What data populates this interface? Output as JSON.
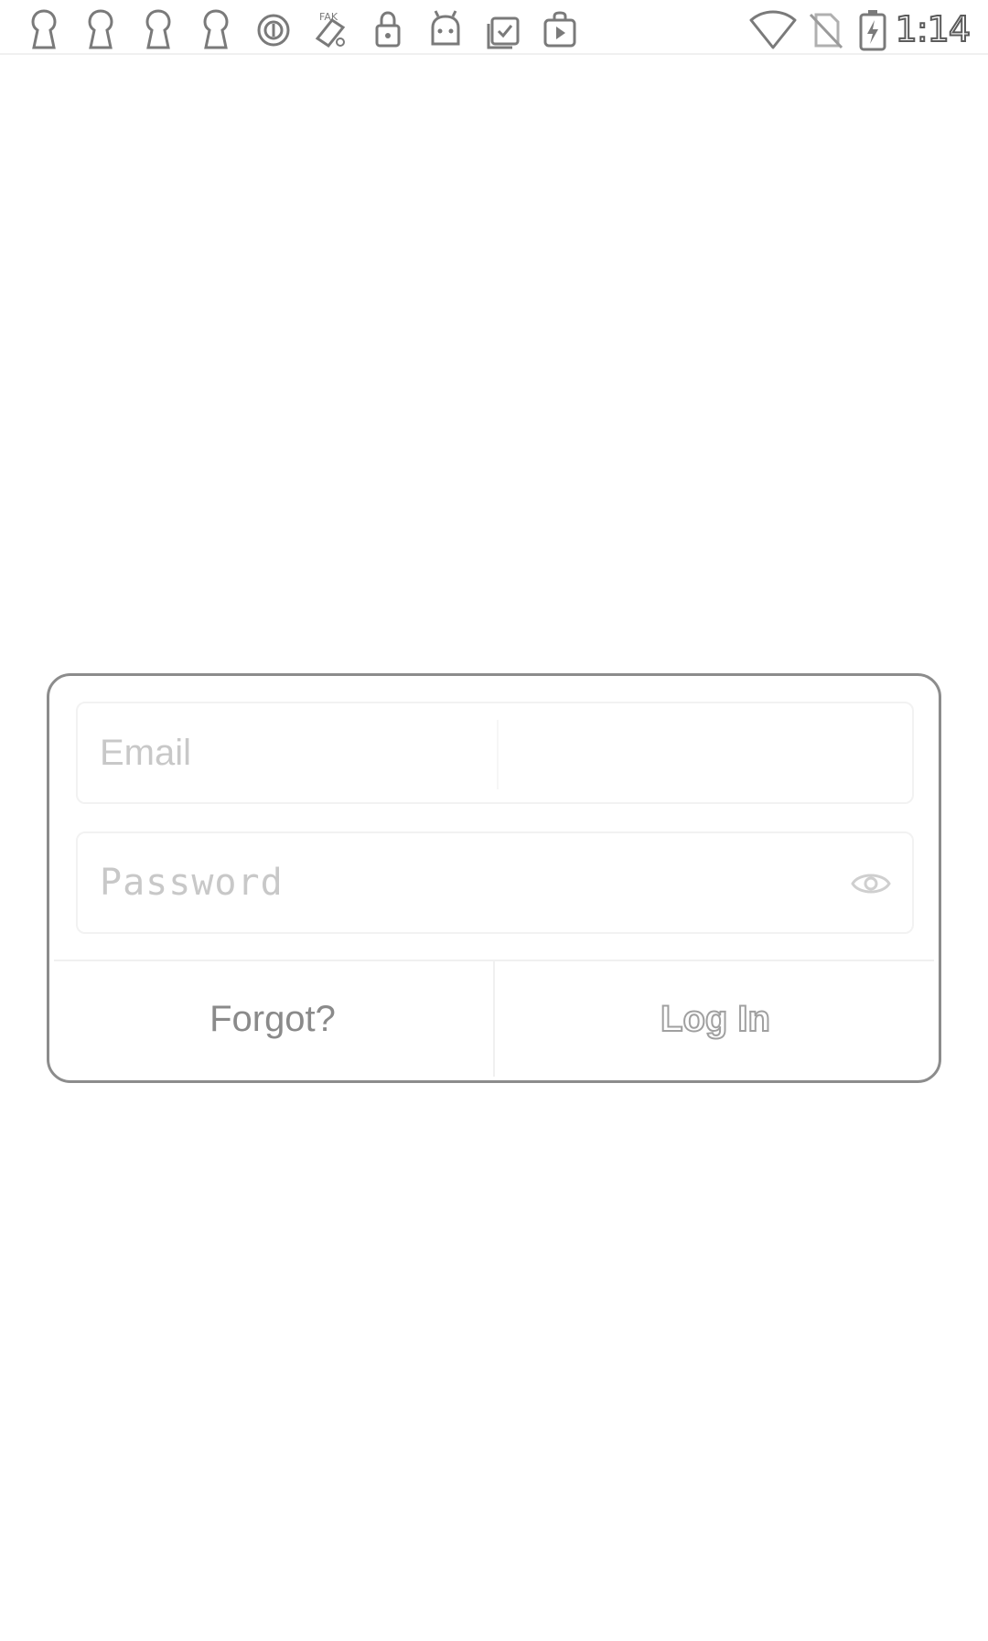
{
  "status_bar": {
    "time": "1:14",
    "left_icons": [
      "keyhole-icon",
      "keyhole-icon",
      "keyhole-icon",
      "keyhole-icon",
      "data-saver-icon",
      "fake-gps-icon",
      "lock-icon",
      "android-icon",
      "task-check-icon",
      "play-store-icon"
    ],
    "right_icons": [
      "wifi-icon",
      "no-sim-icon",
      "battery-charging-icon"
    ]
  },
  "login": {
    "email_placeholder": "Email",
    "password_placeholder": "Password",
    "forgot_label": "Forgot?",
    "login_label": "Log In"
  },
  "colors": {
    "card_border": "#8c8c8c",
    "placeholder": "#c8c8c8",
    "forgot_text": "#8a8a8a",
    "field_border": "#f2f2f2"
  }
}
